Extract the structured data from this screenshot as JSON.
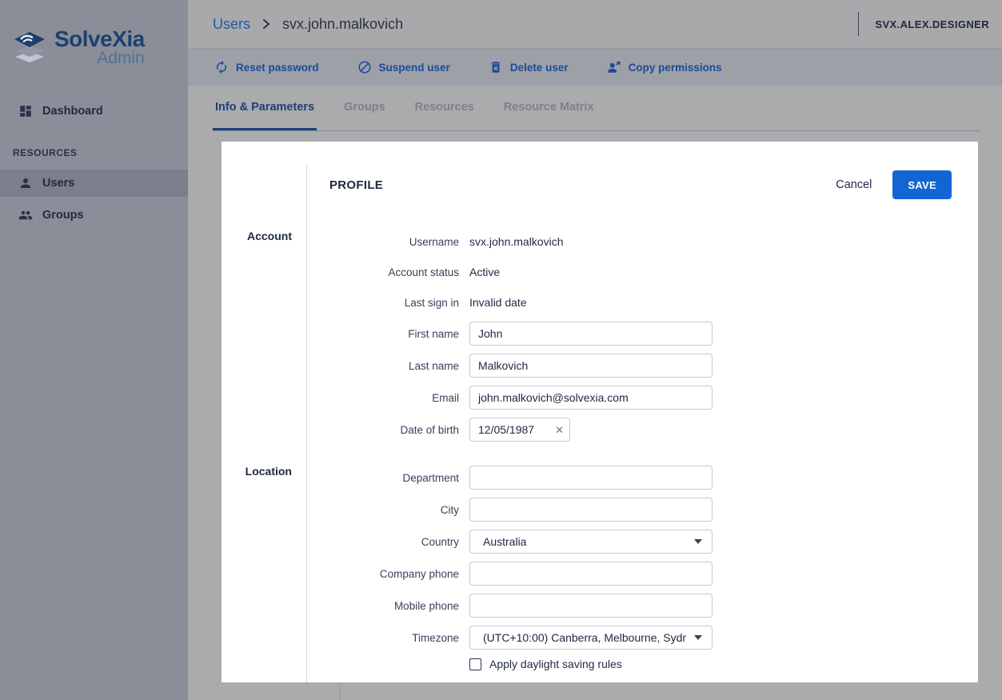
{
  "colors": {
    "accent": "#1266d3",
    "link_blue": "#2456a8",
    "navy_text": "#212a45",
    "toolbar_action_blue": "#1b4b99",
    "sidebar_bg": "#8b8e98",
    "sidebar_selected_bg": "#7b7f8b",
    "topbar_bg": "#a9a9ab",
    "toolbar_bg": "#9da0a7",
    "content_bg": "#aaabad",
    "card_bg": "#ffffff"
  },
  "sidebar": {
    "logo": {
      "title": "SolveXia",
      "subtitle": "Admin",
      "icon": "layers-logo-icon"
    },
    "dashboard": {
      "label": "Dashboard",
      "icon": "dashboard-icon"
    },
    "section_title": "RESOURCES",
    "items": [
      {
        "label": "Users",
        "icon": "user-icon",
        "active": true
      },
      {
        "label": "Groups",
        "icon": "group-icon",
        "active": false
      }
    ]
  },
  "topbar": {
    "breadcrumb": {
      "root": "Users",
      "current": "svx.john.malkovich"
    },
    "account_name": "SVX.ALEX.DESIGNER"
  },
  "toolbar": {
    "actions": [
      {
        "label": "Reset password",
        "icon": "reset-password-icon"
      },
      {
        "label": "Suspend user",
        "icon": "suspend-user-icon"
      },
      {
        "label": "Delete user",
        "icon": "delete-user-icon"
      },
      {
        "label": "Copy permissions",
        "icon": "copy-permissions-icon"
      }
    ]
  },
  "tabs": [
    {
      "label": "Info & Parameters",
      "active": true
    },
    {
      "label": "Groups",
      "active": false
    },
    {
      "label": "Resources",
      "active": false
    },
    {
      "label": "Resource Matrix",
      "active": false
    }
  ],
  "profile": {
    "title": "PROFILE",
    "cancel_label": "Cancel",
    "save_label": "SAVE",
    "account": {
      "section_label": "Account",
      "username": {
        "label": "Username",
        "value": "svx.john.malkovich"
      },
      "status": {
        "label": "Account status",
        "value": "Active"
      },
      "last_sign_in": {
        "label": "Last sign in",
        "value": "Invalid date"
      },
      "first_name": {
        "label": "First name",
        "value": "John"
      },
      "last_name": {
        "label": "Last name",
        "value": "Malkovich"
      },
      "email": {
        "label": "Email",
        "value": "john.malkovich@solvexia.com"
      },
      "date_of_birth": {
        "label": "Date of birth",
        "value": "12/05/1987",
        "clear_icon": "clear-x-icon"
      }
    },
    "location": {
      "section_label": "Location",
      "department": {
        "label": "Department",
        "value": ""
      },
      "city": {
        "label": "City",
        "value": ""
      },
      "country": {
        "label": "Country",
        "value": "Australia"
      },
      "company_phone": {
        "label": "Company phone",
        "value": ""
      },
      "mobile_phone": {
        "label": "Mobile phone",
        "value": ""
      },
      "timezone": {
        "label": "Timezone",
        "value": "(UTC+10:00) Canberra, Melbourne, Sydr"
      },
      "daylight_saving": {
        "label": "Apply daylight saving rules",
        "checked": false
      }
    }
  }
}
